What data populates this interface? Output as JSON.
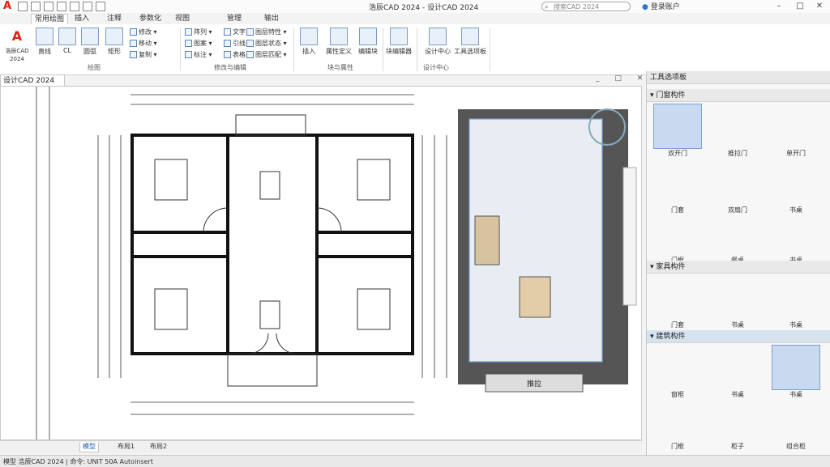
{
  "titlebar": {
    "app_title": "浩辰CAD 2024 - 设计CAD 2024",
    "search_placeholder": "搜索CAD 2024",
    "user_label": "登录账户"
  },
  "ribbon_tabs": [
    "常用绘图",
    "插入",
    "注释",
    "参数化",
    "视图",
    "管理",
    "输出"
  ],
  "ribbon_tab_active_index": 0,
  "ribbon": {
    "big_buttons": [
      {
        "label": "浩辰CAD 2024",
        "icon": "app-menu-icon"
      },
      {
        "label": "直线",
        "icon": "line-icon"
      },
      {
        "label": "CL",
        "icon": "polyline-icon"
      },
      {
        "label": "圆弧",
        "icon": "arc-icon"
      },
      {
        "label": "矩形",
        "icon": "rectangle-icon"
      }
    ],
    "draw_small": [
      "修改 ▾",
      "移动 ▾",
      "复制 ▾"
    ],
    "modify_small": [
      "阵列 ▾",
      "图案 ▾",
      "标注 ▾"
    ],
    "annotate_small": [
      "文字 ▾",
      "引线 ▾",
      "表格 ▾"
    ],
    "layer_small": [
      "图层特性 ▾",
      "图层状态 ▾",
      "图层匹配 ▾"
    ],
    "block_buttons": [
      {
        "label": "插入",
        "icon": "insert-block-icon"
      },
      {
        "label": "属性定义",
        "icon": "attribute-icon"
      },
      {
        "label": "编辑块",
        "icon": "edit-block-icon"
      },
      {
        "label": "块编辑器",
        "icon": "block-editor-icon"
      },
      {
        "label": "设计中心",
        "icon": "design-center-icon"
      },
      {
        "label": "工具选项板",
        "icon": "tool-palette-icon"
      }
    ],
    "panel_labels": [
      "绘图",
      "修改与编辑",
      "块与属性",
      "设计中心"
    ]
  },
  "document_tab": "设计CAD 2024",
  "drawing": {
    "palette_item_labels": [
      "推拉"
    ]
  },
  "palette": {
    "title": "工具选项板",
    "sections": [
      "门窗构件",
      "家具构件",
      "建筑构件"
    ],
    "items_section1": [
      "双开门",
      "推拉门",
      "单开门",
      "门套",
      "双扇门",
      "书桌",
      "门框",
      "餐桌",
      "书桌"
    ],
    "items_section2": [
      "门套",
      "书桌",
      "书桌"
    ],
    "items_section3": [
      "窗框",
      "书桌",
      "书桌",
      "门框",
      "柜子",
      "组合柜"
    ]
  },
  "layout_tabs": [
    "模型",
    "布局1",
    "布局2"
  ],
  "layout_tab_active_index": 0,
  "status": {
    "text": "模型  浩辰CAD 2024 | 命令: UNIT 50A Autoinsert"
  }
}
